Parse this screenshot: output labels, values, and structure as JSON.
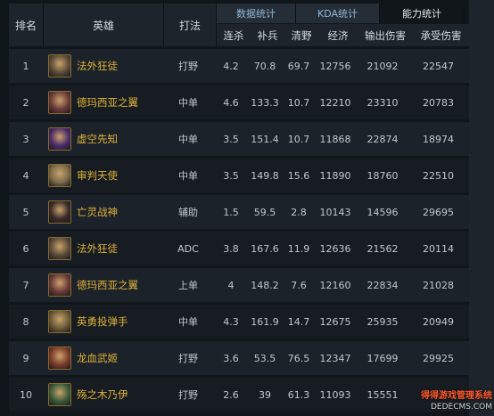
{
  "header": {
    "rank": "排名",
    "hero": "英雄",
    "role": "打法"
  },
  "tabs": [
    {
      "label": "数据统计",
      "active": false
    },
    {
      "label": "KDA统计",
      "active": false
    },
    {
      "label": "能力统计",
      "active": true
    }
  ],
  "columns": [
    "连杀",
    "补兵",
    "清野",
    "经济",
    "输出伤害",
    "承受伤害"
  ],
  "rows": [
    {
      "rank": "1",
      "hero": "法外狂徒",
      "role": "打野",
      "streak": "4.2",
      "cs": "70.8",
      "jungle": "69.7",
      "gold": "12756",
      "dealt": "21092",
      "taken": "22547",
      "avatar_color": "#5a4a3a"
    },
    {
      "rank": "2",
      "hero": "德玛西亚之翼",
      "role": "中单",
      "streak": "4.6",
      "cs": "133.3",
      "jungle": "10.7",
      "gold": "12210",
      "dealt": "23310",
      "taken": "20783",
      "avatar_color": "#6a3a3a"
    },
    {
      "rank": "3",
      "hero": "虚空先知",
      "role": "中单",
      "streak": "3.5",
      "cs": "151.4",
      "jungle": "10.7",
      "gold": "11868",
      "dealt": "22874",
      "taken": "18974",
      "avatar_color": "#4a2a6a"
    },
    {
      "rank": "4",
      "hero": "审判天使",
      "role": "中单",
      "streak": "3.5",
      "cs": "149.8",
      "jungle": "15.6",
      "gold": "11890",
      "dealt": "18760",
      "taken": "22510",
      "avatar_color": "#7a6a4a"
    },
    {
      "rank": "5",
      "hero": "亡灵战神",
      "role": "辅助",
      "streak": "1.5",
      "cs": "59.5",
      "jungle": "2.8",
      "gold": "10143",
      "dealt": "14596",
      "taken": "29695",
      "avatar_color": "#3a2a2a"
    },
    {
      "rank": "6",
      "hero": "法外狂徒",
      "role": "ADC",
      "streak": "3.8",
      "cs": "167.6",
      "jungle": "11.9",
      "gold": "12636",
      "dealt": "21562",
      "taken": "20114",
      "avatar_color": "#5a4a3a"
    },
    {
      "rank": "7",
      "hero": "德玛西亚之翼",
      "role": "上单",
      "streak": "4",
      "cs": "148.2",
      "jungle": "7.6",
      "gold": "12160",
      "dealt": "22834",
      "taken": "21028",
      "avatar_color": "#6a3a3a"
    },
    {
      "rank": "8",
      "hero": "英勇投弹手",
      "role": "中单",
      "streak": "4.3",
      "cs": "161.9",
      "jungle": "14.7",
      "gold": "12675",
      "dealt": "25935",
      "taken": "20949",
      "avatar_color": "#6a5a3a"
    },
    {
      "rank": "9",
      "hero": "龙血武姬",
      "role": "打野",
      "streak": "3.6",
      "cs": "53.5",
      "jungle": "76.5",
      "gold": "12347",
      "dealt": "17699",
      "taken": "29925",
      "avatar_color": "#7a3a2a"
    },
    {
      "rank": "10",
      "hero": "殇之木乃伊",
      "role": "打野",
      "streak": "2.6",
      "cs": "39",
      "jungle": "61.3",
      "gold": "11093",
      "dealt": "15551",
      "taken": "",
      "avatar_color": "#3a5a3a"
    }
  ],
  "watermark": {
    "line1": "得得游戏管理系统",
    "line2": "DEDECMS.COM"
  }
}
